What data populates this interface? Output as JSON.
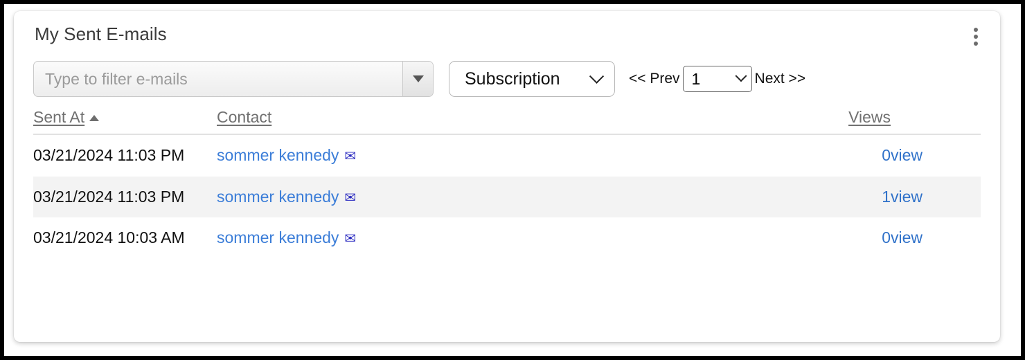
{
  "card": {
    "title": "My Sent E-mails",
    "menu_icon": "kebab-menu-icon"
  },
  "toolbar": {
    "filter_placeholder": "Type to filter e-mails",
    "filter_value": "",
    "filter_dropdown_icon": "triangle-down-icon",
    "subscription_label": "Subscription",
    "prev_label": "<< Prev",
    "page_value": "1",
    "next_label": "Next >>"
  },
  "table": {
    "headers": {
      "sent_at": "Sent At",
      "contact": "Contact",
      "views": "Views",
      "action": ""
    },
    "sort": {
      "column": "Sent At",
      "direction_icon": "sort-ascending-icon"
    },
    "rows": [
      {
        "sent_at": "03/21/2024 11:03 PM",
        "contact": "sommer kennedy",
        "contact_icon": "✉",
        "views": "0",
        "action": "view"
      },
      {
        "sent_at": "03/21/2024 11:03 PM",
        "contact": "sommer kennedy",
        "contact_icon": "✉",
        "views": "1",
        "action": "view"
      },
      {
        "sent_at": "03/21/2024 10:03 AM",
        "contact": "sommer kennedy",
        "contact_icon": "✉",
        "views": "0",
        "action": "view"
      }
    ]
  },
  "colors": {
    "link": "#2f71c9",
    "contact_link": "#3b7dd8",
    "envelope": "#2a2ac0",
    "header_text": "#707070",
    "stripe": "#f3f3f3"
  }
}
